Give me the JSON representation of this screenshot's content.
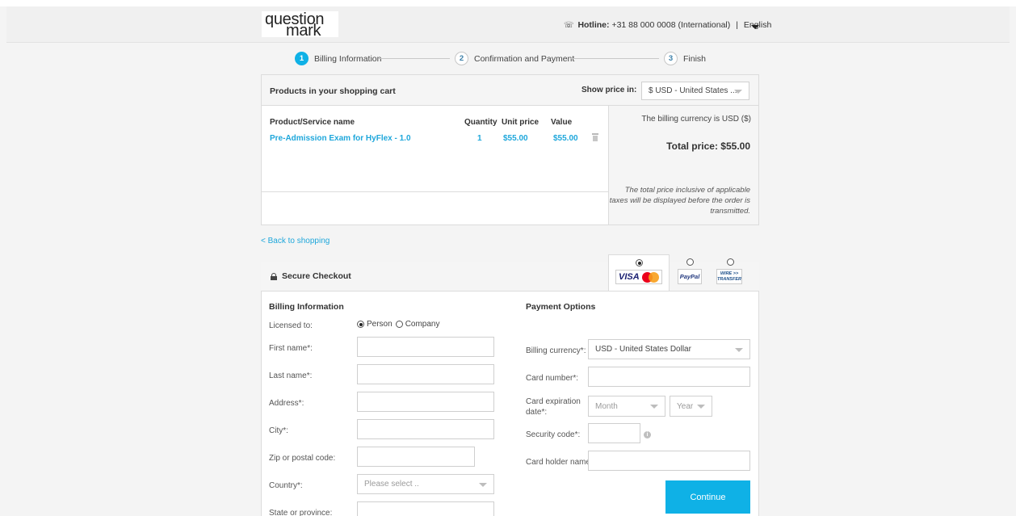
{
  "header": {
    "logo_line1": "question",
    "logo_line2": "mark",
    "hotline_label": "Hotline:",
    "hotline_text": "+31 88 000 0008 (International)",
    "separator": "|",
    "language": "English"
  },
  "steps": [
    {
      "number": "1",
      "label": "Billing Information",
      "active": true
    },
    {
      "number": "2",
      "label": "Confirmation and Payment",
      "active": false
    },
    {
      "number": "3",
      "label": "Finish",
      "active": false
    }
  ],
  "cart": {
    "title": "Products in your shopping cart",
    "show_price_label": "Show price in:",
    "currency_select": "$ USD - United States ...",
    "columns": [
      "Product/Service name",
      "Quantity",
      "Unit price",
      "Value"
    ],
    "items": [
      {
        "name": "Pre-Admission Exam for HyFlex - 1.0",
        "quantity": "1",
        "unit_price": "$55.00",
        "value": "$55.00"
      }
    ],
    "billing_currency_note": "The billing currency is USD ($)",
    "total": "Total price: $55.00",
    "tax_note": "The total price inclusive of applicable taxes will be displayed before the order is transmitted."
  },
  "back_link": "< Back to shopping",
  "checkout": {
    "title": "Secure Checkout",
    "payment_methods": [
      {
        "name": "visa-mastercard",
        "visa_text": "VISA",
        "selected": true
      },
      {
        "name": "paypal",
        "text": "PayPal",
        "selected": false
      },
      {
        "name": "wire-transfer",
        "text_line1": "WIRE >>",
        "text_line2": "TRANSFER",
        "selected": false
      }
    ],
    "billing": {
      "title": "Billing Information",
      "licensed_to_label": "Licensed to:",
      "person_label": "Person",
      "company_label": "Company",
      "first_name_label": "First name*:",
      "last_name_label": "Last name*:",
      "address_label": "Address*:",
      "city_label": "City*:",
      "zip_label": "Zip or postal code:",
      "country_label": "Country*:",
      "country_placeholder": "Please select ..",
      "state_label": "State or province:"
    },
    "payment": {
      "title": "Payment Options",
      "billing_currency_label": "Billing currency*:",
      "billing_currency_value": "USD - United States Dollar",
      "card_number_label": "Card number*:",
      "card_expiration_label_line1": "Card expiration",
      "card_expiration_label_line2": "date*:",
      "month_placeholder": "Month",
      "year_placeholder": "Year",
      "security_code_label": "Security code*:",
      "card_holder_label": "Card holder name*:",
      "continue_label": "Continue"
    }
  },
  "colors": {
    "accent": "#0fb1e6",
    "link": "#1fa7db",
    "panel_bg": "#f5f5f5",
    "page_bg": "#f4f4f4"
  }
}
